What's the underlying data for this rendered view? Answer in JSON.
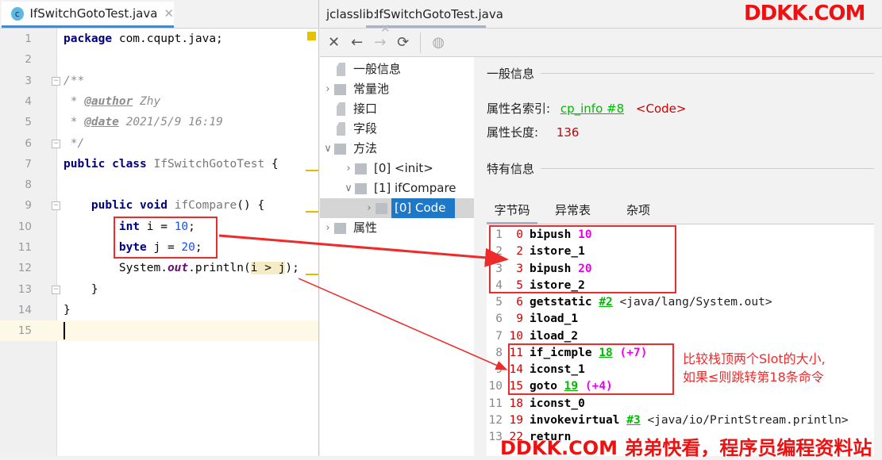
{
  "editor": {
    "tab_label": "IfSwitchGotoTest.java",
    "lines": [
      [
        [
          "package",
          "kw"
        ],
        [
          " com.cqupt.java;",
          ""
        ]
      ],
      [],
      [
        [
          "/**",
          "cm"
        ]
      ],
      [
        [
          " * ",
          "cm"
        ],
        [
          "@author",
          "tag"
        ],
        [
          " Zhy",
          "cm"
        ]
      ],
      [
        [
          " * ",
          "cm"
        ],
        [
          "@date",
          "tag"
        ],
        [
          " 2021/5/9 16:19",
          "cm"
        ]
      ],
      [
        [
          " */",
          "cm"
        ]
      ],
      [
        [
          "public class",
          "kw"
        ],
        [
          " ",
          ""
        ],
        [
          "IfSwitchGotoTest",
          "cls"
        ],
        [
          " {",
          ""
        ]
      ],
      [],
      [
        [
          "    public void",
          "kw"
        ],
        [
          " ",
          ""
        ],
        [
          "ifCompare",
          "cls"
        ],
        [
          "() {",
          ""
        ]
      ],
      [
        [
          "        int",
          "kw"
        ],
        [
          " i = ",
          ""
        ],
        [
          "10",
          "num"
        ],
        [
          ";",
          ""
        ]
      ],
      [
        [
          "        byte",
          "kw"
        ],
        [
          " j = ",
          ""
        ],
        [
          "20",
          "num"
        ],
        [
          ";",
          ""
        ]
      ],
      [
        [
          "        System.",
          ""
        ],
        [
          "out",
          "fld"
        ],
        [
          ".println(",
          ""
        ],
        [
          "i > j",
          "hl"
        ],
        [
          ");",
          ""
        ]
      ],
      [
        [
          "    }",
          ""
        ]
      ],
      [
        [
          "}",
          ""
        ]
      ],
      []
    ]
  },
  "jclasslib": {
    "tab_prefix": "jclasslib:",
    "tab_label": "IfSwitchGotoTest.java",
    "toolbar": [
      "close-icon",
      "back-icon",
      "forward-icon",
      "refresh-icon",
      "browser-icon"
    ],
    "tree": [
      {
        "label": "一般信息",
        "level": 0,
        "type": "page",
        "chev": ""
      },
      {
        "label": "常量池",
        "level": 0,
        "type": "folder",
        "chev": "›"
      },
      {
        "label": "接口",
        "level": 0,
        "type": "page",
        "chev": ""
      },
      {
        "label": "字段",
        "level": 0,
        "type": "page",
        "chev": ""
      },
      {
        "label": "方法",
        "level": 0,
        "type": "folder",
        "chev": "⌄"
      },
      {
        "label": "[0] <init>",
        "level": 1,
        "type": "folder",
        "chev": "›"
      },
      {
        "label": "[1] ifCompare",
        "level": 1,
        "type": "folder",
        "chev": "⌄"
      },
      {
        "label": "[0] Code",
        "level": 2,
        "type": "folder",
        "chev": "›",
        "selected": true
      },
      {
        "label": "属性",
        "level": 0,
        "type": "folder",
        "chev": "›"
      }
    ],
    "detail": {
      "general_title": "一般信息",
      "name_index_label": "属性名索引:",
      "name_index_link": "cp_info #8",
      "name_index_value": "<Code>",
      "length_label": "属性长度:",
      "length_value": "136",
      "specific_title": "特有信息",
      "tabs": [
        "字节码",
        "异常表",
        "杂项"
      ],
      "active_tab": "字节码",
      "bytecode": [
        [
          "1",
          "0",
          "bipush",
          [
            [
              "10",
              "m"
            ]
          ]
        ],
        [
          "2",
          "2",
          "istore_1",
          []
        ],
        [
          "3",
          "3",
          "bipush",
          [
            [
              "20",
              "m"
            ]
          ]
        ],
        [
          "4",
          "5",
          "istore_2",
          []
        ],
        [
          "5",
          "6",
          "getstatic",
          [
            [
              "#2",
              "g"
            ],
            [
              "<java/lang/System.out>",
              ""
            ]
          ]
        ],
        [
          "6",
          "9",
          "iload_1",
          []
        ],
        [
          "7",
          "10",
          "iload_2",
          []
        ],
        [
          "8",
          "11",
          "if_icmple",
          [
            [
              "18",
              "g"
            ],
            [
              "(+7)",
              "m"
            ]
          ]
        ],
        [
          "9",
          "14",
          "iconst_1",
          []
        ],
        [
          "10",
          "15",
          "goto",
          [
            [
              "19",
              "g"
            ],
            [
              "(+4)",
              "m"
            ]
          ]
        ],
        [
          "11",
          "18",
          "iconst_0",
          []
        ],
        [
          "12",
          "19",
          "invokevirtual",
          [
            [
              "#3",
              "g"
            ],
            [
              "<java/io/PrintStream.println>",
              ""
            ]
          ]
        ],
        [
          "13",
          "22",
          "return",
          []
        ]
      ]
    }
  },
  "annotation": {
    "line1": "比较栈顶两个Slot的大小,",
    "line2": "如果≤则跳转第18条命令"
  },
  "watermark": {
    "top": "DDKK.COM",
    "bottom": "DDKK.COM 弟弟快看，程序员编程资料站"
  },
  "colors": {
    "annotation": "#ee2a2a",
    "selection": "#1e78c8",
    "link": "#00bb00"
  }
}
